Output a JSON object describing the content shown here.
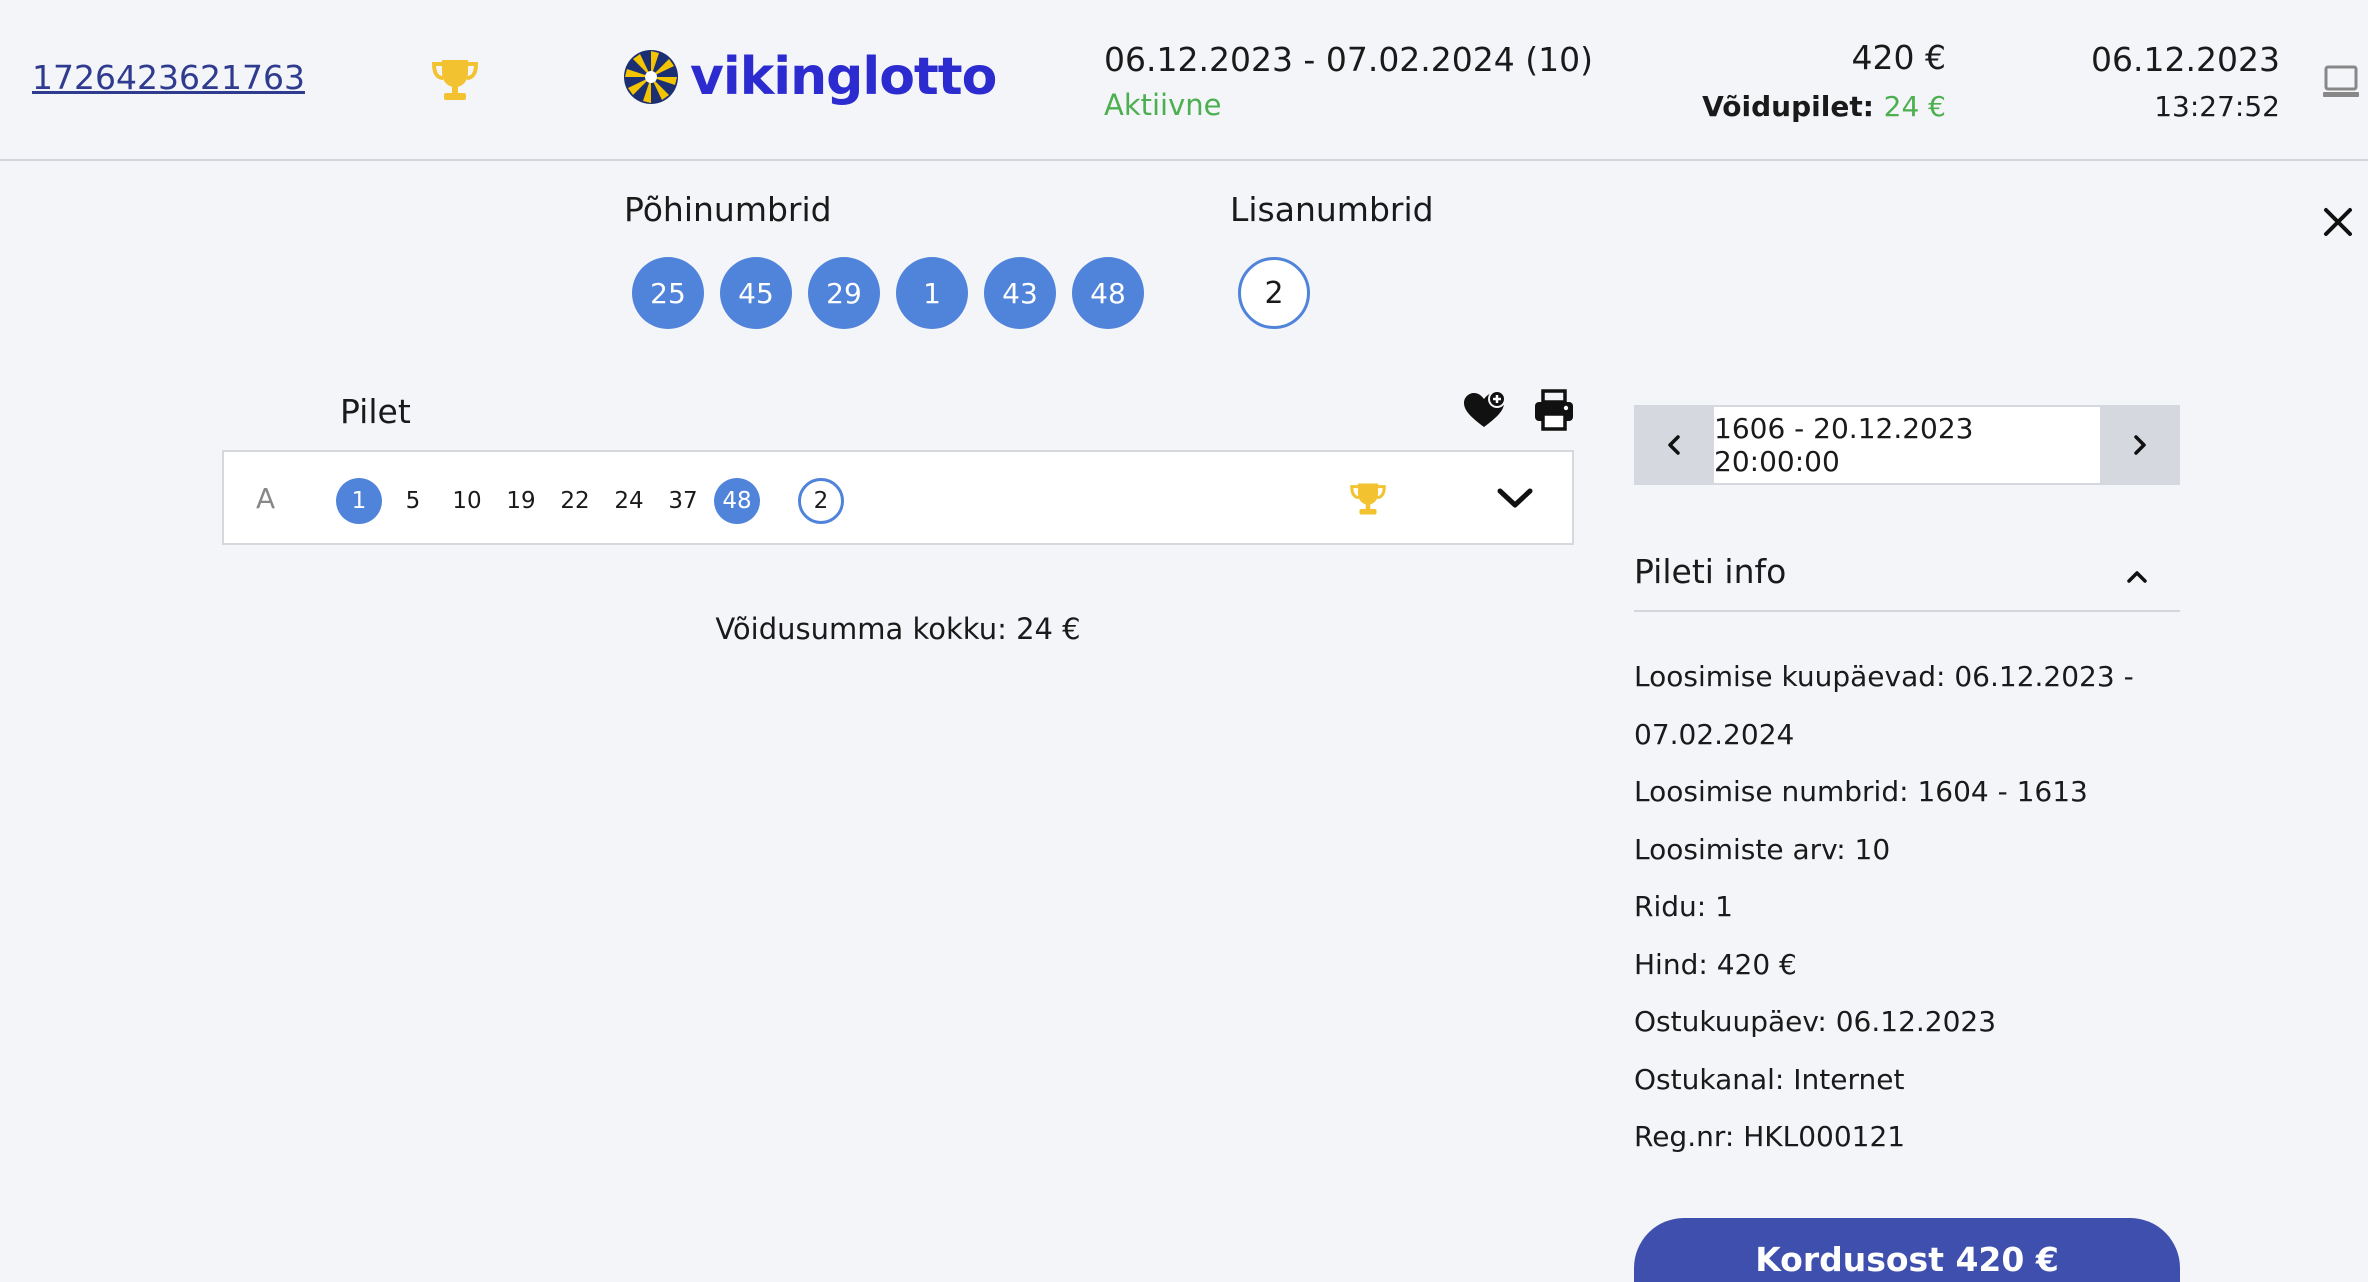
{
  "header": {
    "ticket_id": "1726423621763",
    "logo_text": "vikinglotto",
    "period": "06.12.2023 - 07.02.2024 (10)",
    "status": "Aktiivne",
    "price": "420 €",
    "win_label": "Võidupilet:",
    "win_amount": "24 €",
    "date": "06.12.2023",
    "time": "13:27:52"
  },
  "draw_result": {
    "main_label": "Põhinumbrid",
    "main_numbers": [
      "25",
      "45",
      "29",
      "1",
      "43",
      "48"
    ],
    "extra_label": "Lisanumbrid",
    "extra_numbers": [
      "2"
    ]
  },
  "ticket": {
    "label": "Pilet",
    "rows": [
      {
        "letter": "A",
        "numbers": [
          {
            "value": "1",
            "hit": true
          },
          {
            "value": "5",
            "hit": false
          },
          {
            "value": "10",
            "hit": false
          },
          {
            "value": "19",
            "hit": false
          },
          {
            "value": "22",
            "hit": false
          },
          {
            "value": "24",
            "hit": false
          },
          {
            "value": "37",
            "hit": false
          },
          {
            "value": "48",
            "hit": true
          }
        ],
        "extra": "2"
      }
    ],
    "win_total": "Võidusumma kokku: 24 €"
  },
  "draw_selector": {
    "value": "1606 - 20.12.2023 20:00:00"
  },
  "info": {
    "title": "Pileti info",
    "items": [
      "Loosimise kuupäevad: 06.12.2023 -",
      "07.02.2024",
      "Loosimise numbrid: 1604 - 1613",
      "Loosimiste arv: 10",
      "Ridu: 1",
      "Hind: 420 €",
      "Ostukuupäev: 06.12.2023",
      "Ostukanal: Internet",
      "Reg.nr: HKL000121"
    ]
  },
  "repeat_button": "Kordusost 420 €",
  "colors": {
    "accent_blue": "#5083da",
    "logo_blue": "#2b2bd0",
    "button_blue": "#3e4fae",
    "status_green": "#4caf50",
    "trophy_gold": "#f2c230"
  },
  "icons": [
    "trophy-icon",
    "device-icon",
    "close-icon",
    "favorite-heart-icon",
    "print-icon",
    "chevron-down-icon",
    "chevron-left-icon",
    "chevron-right-icon",
    "chevron-up-icon"
  ]
}
